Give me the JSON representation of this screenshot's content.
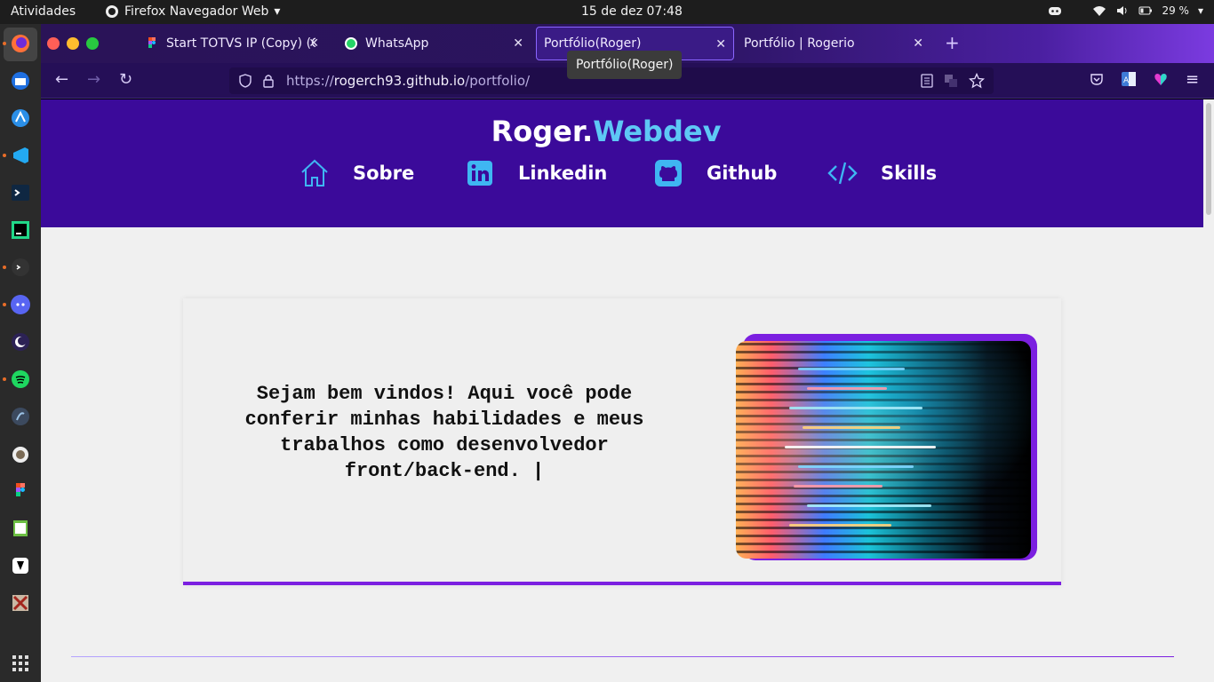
{
  "system": {
    "activities": "Atividades",
    "app_menu": "Firefox Navegador Web",
    "clock": "15 de dez  07:48",
    "battery": "29 %"
  },
  "dock": {
    "apps": [
      "firefox-icon",
      "thunderbird-icon",
      "app-store-icon",
      "vscode-icon",
      "terminal-icon",
      "pycharm-icon",
      "console-icon",
      "discord-icon",
      "eclipse-icon",
      "spotify-icon",
      "database-icon",
      "gimp-icon",
      "figma-icon",
      "gedit-icon",
      "inkscape-icon",
      "tools-icon",
      "app-grid-icon"
    ]
  },
  "browser": {
    "tabs": [
      {
        "title": "Start TOTVS IP (Copy) (Co",
        "active": false
      },
      {
        "title": "WhatsApp",
        "active": false
      },
      {
        "title": "Portfólio(Roger)",
        "active": true
      },
      {
        "title": "Portfólio | Rogerio",
        "active": false
      }
    ],
    "tooltip": "Portfólio(Roger)",
    "url_scheme": "https://",
    "url_host": "rogerch93.github.io",
    "url_path": "/portfolio/"
  },
  "site": {
    "brand_main": "Roger.",
    "brand_accent": "Webdev",
    "nav": [
      {
        "label": "Sobre",
        "icon": "home-icon"
      },
      {
        "label": "Linkedin",
        "icon": "linkedin-icon"
      },
      {
        "label": "Github",
        "icon": "github-icon"
      },
      {
        "label": "Skills",
        "icon": "code-icon"
      }
    ],
    "welcome_text": "Sejam bem vindos! Aqui você pode conferir minhas habilidades e meus trabalhos como desenvolvedor front/back-end.  |",
    "colors": {
      "header_bg": "#3b0a9a",
      "accent": "#5ec8f5",
      "purple": "#7b1fe0"
    }
  }
}
